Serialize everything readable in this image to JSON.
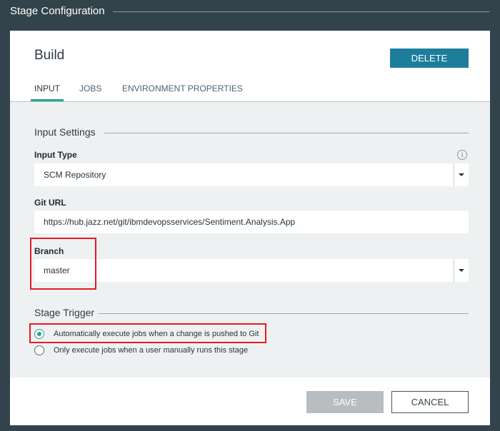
{
  "window": {
    "title": "Stage Configuration"
  },
  "header": {
    "title": "Build",
    "delete_label": "DELETE"
  },
  "tabs": [
    {
      "label": "INPUT",
      "active": true
    },
    {
      "label": "JOBS",
      "active": false
    },
    {
      "label": "ENVIRONMENT PROPERTIES",
      "active": false
    }
  ],
  "input_settings": {
    "title": "Input Settings",
    "input_type": {
      "label": "Input Type",
      "value": "SCM Repository"
    },
    "git_url": {
      "label": "Git URL",
      "value": "https://hub.jazz.net/git/ibmdevopsservices/Sentiment.Analysis.App"
    },
    "branch": {
      "label": "Branch",
      "value": "master"
    }
  },
  "stage_trigger": {
    "title": "Stage Trigger",
    "options": [
      {
        "label": "Automatically execute jobs when a change is pushed to Git",
        "selected": true
      },
      {
        "label": "Only execute jobs when a user manually runs this stage",
        "selected": false
      }
    ]
  },
  "footer": {
    "save_label": "SAVE",
    "cancel_label": "CANCEL"
  },
  "colors": {
    "accent": "#2ba38f",
    "primary_button": "#1d7e9c",
    "highlight": "#e31b23",
    "backdrop": "#33434c"
  },
  "icons": {
    "info": "info-icon",
    "dropdown": "chevron-down-icon",
    "radio_selected": "radio-checked-icon",
    "radio_unselected": "radio-unchecked-icon"
  }
}
